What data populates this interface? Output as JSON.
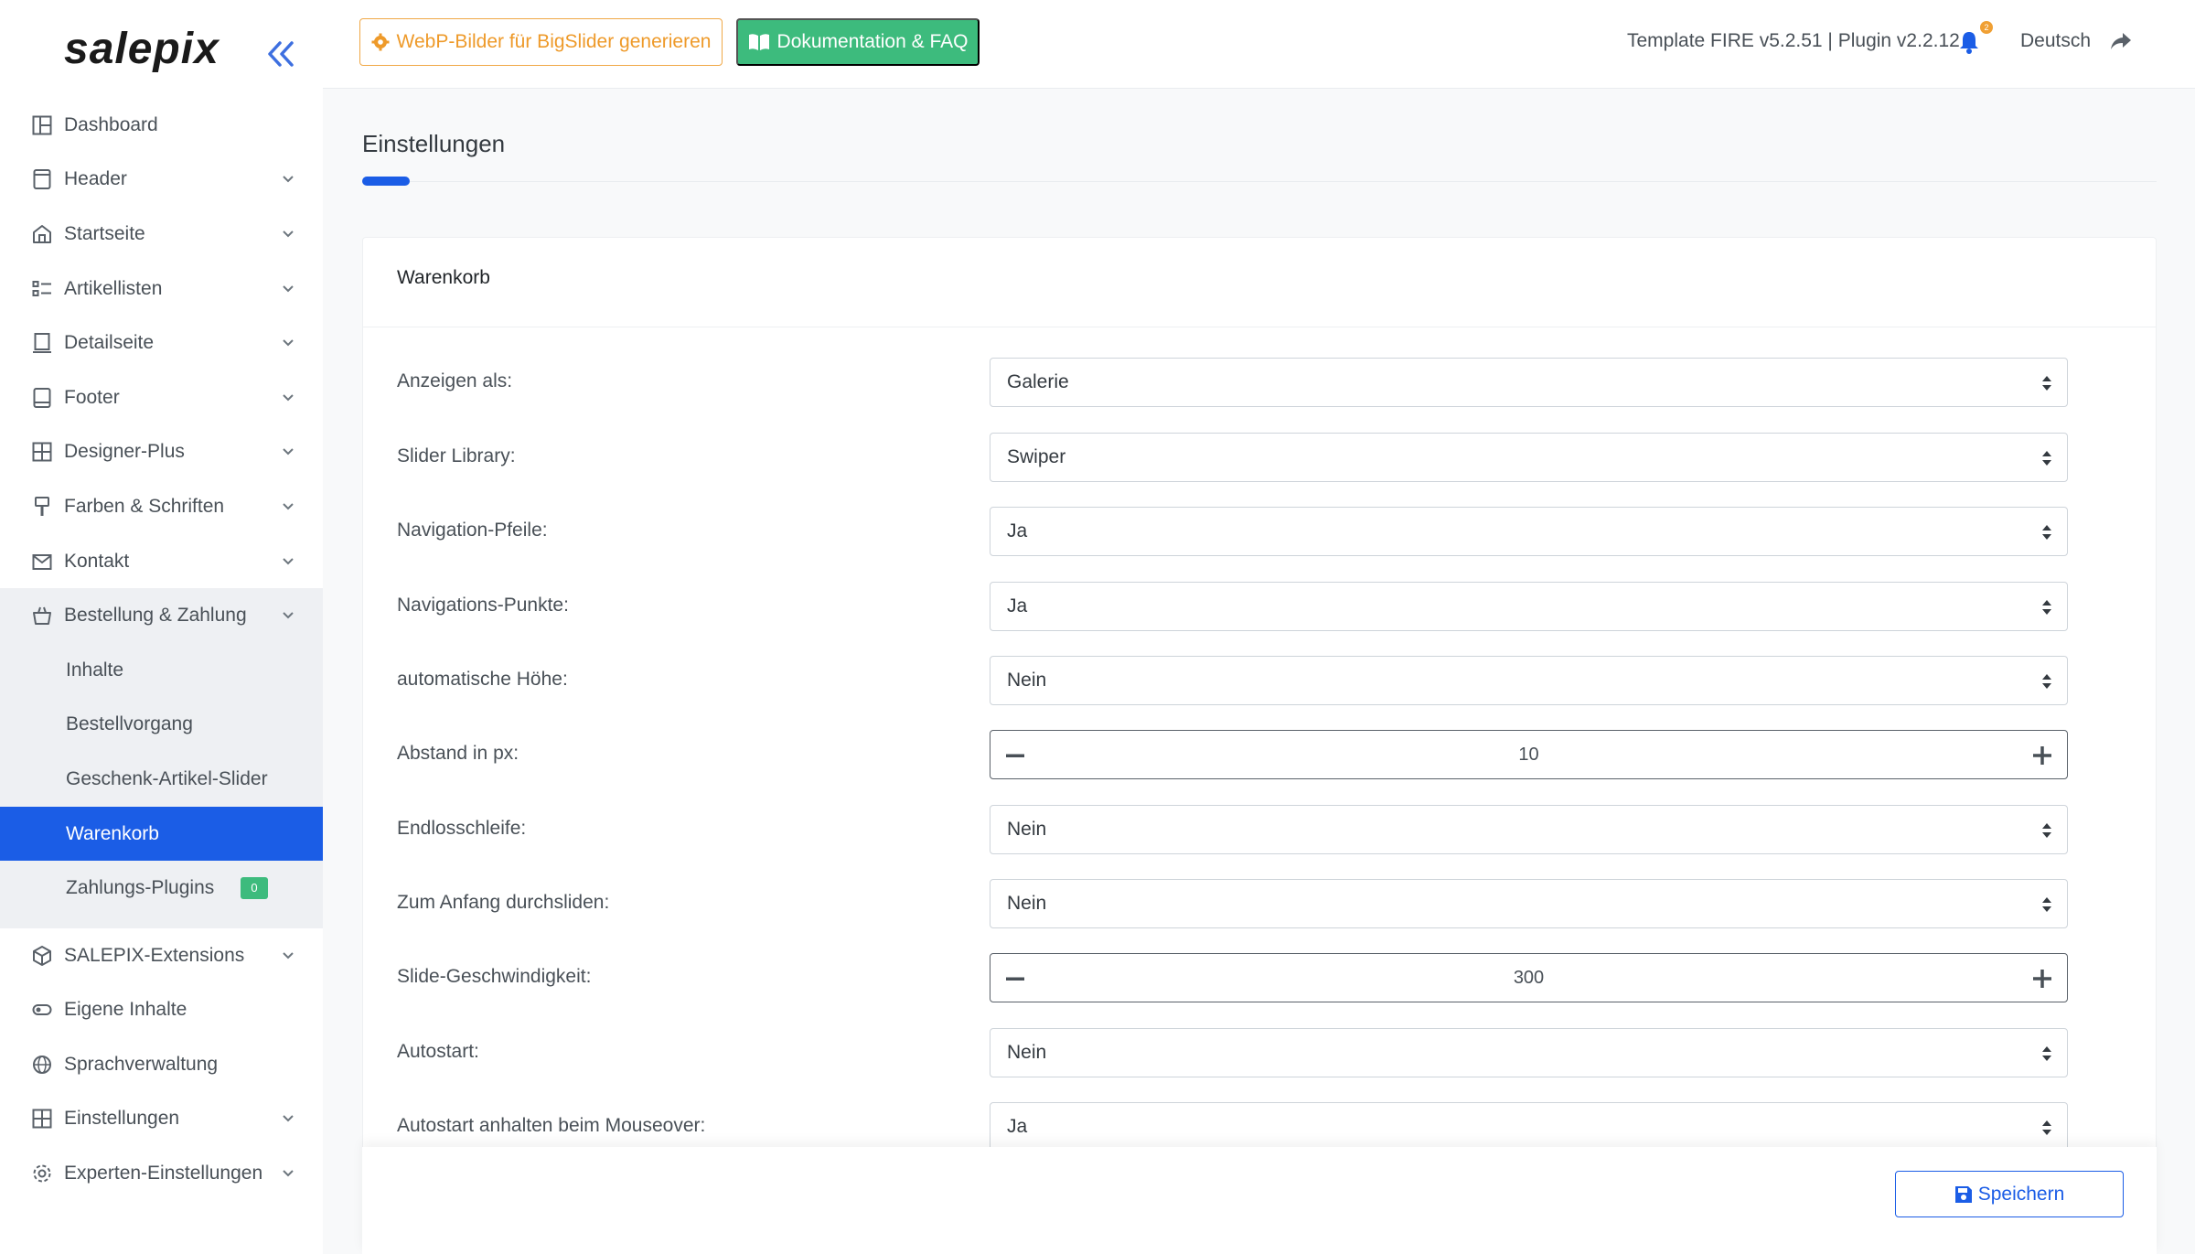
{
  "brand": {
    "logo": "salepix"
  },
  "sidebar": {
    "items": [
      {
        "label": "Dashboard",
        "icon": "dashboard-icon",
        "chevron": false
      },
      {
        "label": "Header",
        "icon": "header-icon",
        "chevron": true
      },
      {
        "label": "Startseite",
        "icon": "home-icon",
        "chevron": true
      },
      {
        "label": "Artikellisten",
        "icon": "list-icon",
        "chevron": true
      },
      {
        "label": "Detailseite",
        "icon": "detail-page-icon",
        "chevron": true
      },
      {
        "label": "Footer",
        "icon": "footer-icon",
        "chevron": true
      },
      {
        "label": "Designer-Plus",
        "icon": "designer-icon",
        "chevron": true
      },
      {
        "label": "Farben & Schriften",
        "icon": "brush-icon",
        "chevron": true
      },
      {
        "label": "Kontakt",
        "icon": "mail-icon",
        "chevron": true
      },
      {
        "label": "Bestellung & Zahlung",
        "icon": "basket-icon",
        "chevron": true
      }
    ],
    "submenu": [
      {
        "label": "Inhalte"
      },
      {
        "label": "Bestellvorgang"
      },
      {
        "label": "Geschenk-Artikel-Slider"
      },
      {
        "label": "Warenkorb",
        "active": true
      },
      {
        "label": "Zahlungs-Plugins",
        "badge": "0"
      }
    ],
    "items_after": [
      {
        "label": "SALEPIX-Extensions",
        "icon": "cube-icon",
        "chevron": true
      },
      {
        "label": "Eigene Inhalte",
        "icon": "toggle-icon",
        "chevron": false
      },
      {
        "label": "Sprachverwaltung",
        "icon": "globe-icon",
        "chevron": false
      },
      {
        "label": "Einstellungen",
        "icon": "grid-icon",
        "chevron": true
      },
      {
        "label": "Experten-Einstellungen",
        "icon": "gear-icon",
        "chevron": true
      }
    ]
  },
  "topbar": {
    "webp_button": "WebP-Bilder für BigSlider generieren",
    "doc_button": "Dokumentation & FAQ",
    "version": "Template FIRE v5.2.51 | Plugin v2.2.12",
    "notification_count": "2",
    "language": "Deutsch"
  },
  "page": {
    "title": "Einstellungen",
    "card_title": "Warenkorb",
    "fields": [
      {
        "label": "Anzeigen als:",
        "type": "select",
        "value": "Galerie"
      },
      {
        "label": "Slider Library:",
        "type": "select",
        "value": "Swiper"
      },
      {
        "label": "Navigation-Pfeile:",
        "type": "select",
        "value": "Ja"
      },
      {
        "label": "Navigations-Punkte:",
        "type": "select",
        "value": "Ja"
      },
      {
        "label": "automatische Höhe:",
        "type": "select",
        "value": "Nein"
      },
      {
        "label": "Abstand in px:",
        "type": "stepper",
        "value": "10"
      },
      {
        "label": "Endlosschleife:",
        "type": "select",
        "value": "Nein"
      },
      {
        "label": "Zum Anfang durchsliden:",
        "type": "select",
        "value": "Nein"
      },
      {
        "label": "Slide-Geschwindigkeit:",
        "type": "stepper",
        "value": "300"
      },
      {
        "label": "Autostart:",
        "type": "select",
        "value": "Nein"
      },
      {
        "label": "Autostart anhalten beim Mouseover:",
        "type": "select",
        "value": "Ja"
      }
    ],
    "save_label": "Speichern"
  },
  "colors": {
    "primary": "#1b5de6",
    "success": "#3dbb7d",
    "warning": "#ee9a2a"
  }
}
